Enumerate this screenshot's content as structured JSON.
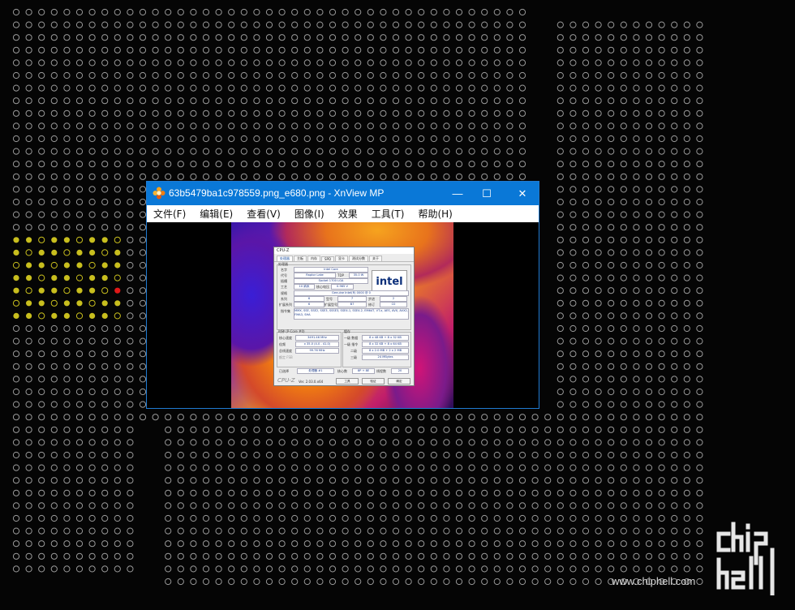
{
  "window": {
    "title": "63b5479ba1c978559.png_e680.png - XnView MP",
    "minimize_glyph": "—",
    "maximize_glyph": "☐",
    "close_glyph": "✕",
    "app_icon": "xnview-flower-icon"
  },
  "menu": [
    {
      "label": "文件(F)"
    },
    {
      "label": "编辑(E)"
    },
    {
      "label": "查看(V)"
    },
    {
      "label": "图像(I)"
    },
    {
      "label": "效果"
    },
    {
      "label": "工具(T)"
    },
    {
      "label": "帮助(H)"
    }
  ],
  "cpuz": {
    "title": "CPU-Z",
    "tabs": [
      "处理器",
      "主板",
      "内存",
      "SPD",
      "显卡",
      "测试分数",
      "关于"
    ],
    "section_processor": "处理器",
    "name_label": "名字",
    "name_value": "Intel Core",
    "codename_label": "代号",
    "codename_value": "Raptor Lake",
    "tdp_label": "TDP",
    "tdp_value": "35.0 W",
    "socket_label": "插槽",
    "socket_value": "Socket 1700 LGA",
    "tech_label": "工艺",
    "tech_value": "10 纳米",
    "voltage_label": "核心电压",
    "voltage_value": "0.965 V",
    "spec_label": "规格",
    "spec_value": "Genuine Intel(R) 0000 @ 0",
    "family_label": "系列",
    "family_value": "6",
    "model_label": "型号",
    "model_value": "7",
    "stepping_label": "步进",
    "stepping_value": "2",
    "extfamily_label": "扩展系列",
    "extfamily_value": "6",
    "extmodel_label": "扩展型号",
    "extmodel_value": "B7",
    "revision_label": "修订",
    "revision_value": "C0",
    "instr_label": "指令集",
    "instr_value": "MMX, SSE, SSE2, SSE3, SSSE3, SSE4.1, SSE4.2, EM64T, VT-x, AES, AVX, AVX2, FMA3, SHA",
    "clocks_label": "时钟 (P-Core #0)",
    "core_speed_label": "核心速度",
    "core_speed_value": "3491.46 MHz",
    "multiplier_label": "倍频",
    "multiplier_value": "x 35.0 (4.0 - 41.0)",
    "bus_label": "总线速度",
    "bus_value": "99.76 MHz",
    "fsb_label": "额定 FSB",
    "cache_label": "缓存",
    "l1d_label": "一级 数据",
    "l1d_value": "8 x 48 KB + 8 x 32 KB",
    "l1i_label": "一级 指令",
    "l1i_value": "8 x 32 KB + 8 x 64 KB",
    "l2_label": "二级",
    "l2_value": "8 x 2.0 MB + 2 x 2 MB",
    "l3_label": "三级",
    "l3_value": "24 MBytes",
    "selected_label": "已选择",
    "selected_value": "处理器 #1",
    "cores_label": "核心数",
    "cores_value": "8P + 8E",
    "threads_label": "线程数",
    "threads_value": "20",
    "brand": "CPU-Z",
    "version": "Ver. 2.03.0.x64",
    "tools_label": "工具",
    "validate_label": "验证",
    "ok_label": "确定",
    "logo_text": "intel"
  },
  "watermark": {
    "url": "www.chiphell.com",
    "logo": "chiphell-logo"
  },
  "colors": {
    "titlebar": "#0a78d7",
    "dot": "#9a9a9a",
    "dot_yellow": "#c8be1e",
    "dot_red": "#e01818"
  }
}
